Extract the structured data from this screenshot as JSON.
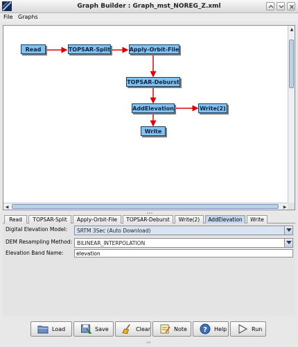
{
  "window": {
    "title": "Graph Builder : Graph_mst_NOREG_Z.xml"
  },
  "menu": {
    "items": [
      "File",
      "Graphs"
    ]
  },
  "graph": {
    "nodes": [
      "Read",
      "TOPSAR-Split",
      "Apply-Orbit-File",
      "TOPSAR-Deburst",
      "AddElevation",
      "Write(2)",
      "Write"
    ]
  },
  "tabs": [
    "Read",
    "TOPSAR-Split",
    "Apply-Orbit-File",
    "TOPSAR-Deburst",
    "Write(2)",
    "AddElevation",
    "Write"
  ],
  "active_tab": "AddElevation",
  "form": {
    "dem_label": "Digital Elevation Model:",
    "dem_value": "SRTM 3Sec (Auto Download)",
    "resampling_label": "DEM Resampling Method:",
    "resampling_value": "BILINEAR_INTERPOLATION",
    "band_label": "Elevation Band Name:",
    "band_value": "elevation"
  },
  "buttons": {
    "load": "Load",
    "save": "Save",
    "clear": "Clear",
    "note": "Note",
    "help": "Help",
    "run": "Run"
  },
  "icons": {
    "load": "folder-icon",
    "save": "save-icon",
    "clear": "broom-icon",
    "note": "note-icon",
    "help": "help-icon",
    "run": "run-icon"
  },
  "colors": {
    "node_fill": "#82c0ee",
    "edge": "#e00000",
    "active_tab": "#c3d6ee"
  }
}
